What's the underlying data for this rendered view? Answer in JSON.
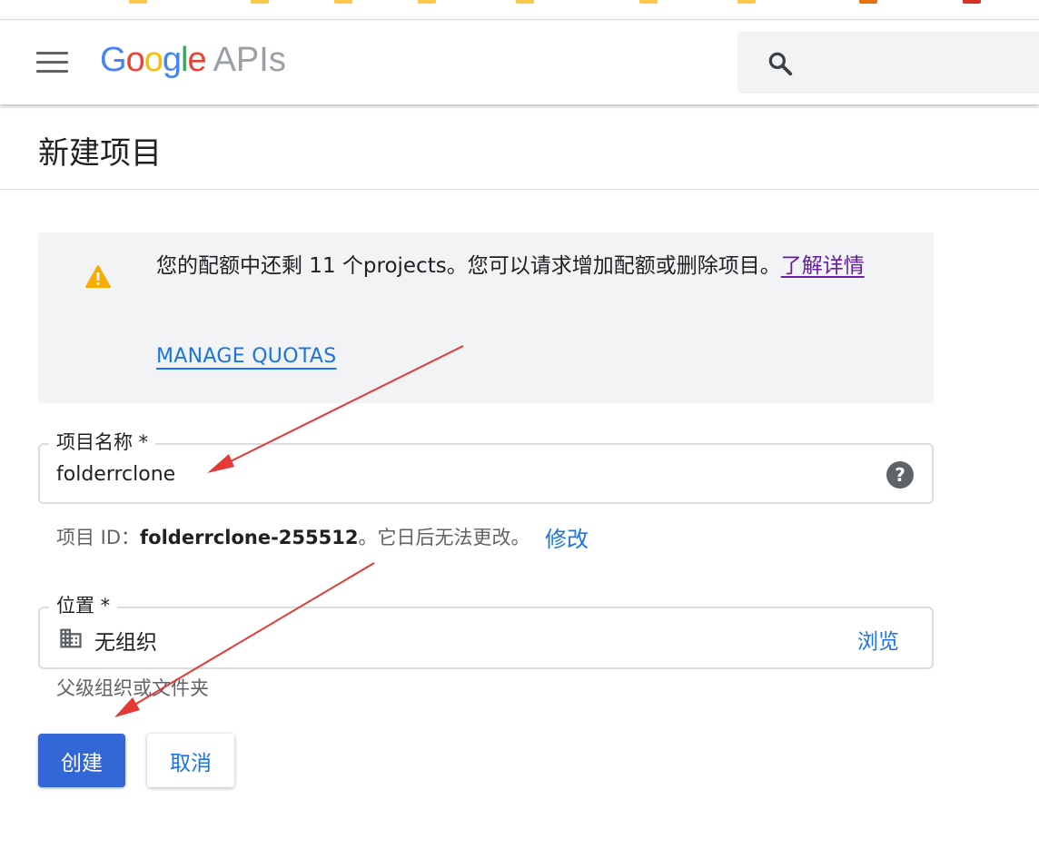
{
  "header": {
    "logo_google": "Google",
    "logo_apis": "APIs",
    "menu_icon": "hamburger-menu-icon",
    "search_icon": "search-icon"
  },
  "page": {
    "title": "新建项目"
  },
  "notice": {
    "icon": "warning-icon",
    "text": "您的配额中还剩 11 个projects。您可以请求增加配额或删除项目。",
    "learn_more": "了解详情",
    "manage_quotas": "MANAGE QUOTAS"
  },
  "project_name": {
    "label": "项目名称 *",
    "value": "folderrclone",
    "help_icon": "help-icon"
  },
  "project_id": {
    "prefix": "项目 ID：",
    "value": "folderrclone-255512",
    "suffix": "。它日后无法更改。",
    "edit": "修改"
  },
  "location": {
    "label": "位置 *",
    "icon": "building-icon",
    "value": "无组织",
    "browse": "浏览",
    "hint": "父级组织或文件夹"
  },
  "actions": {
    "create": "创建",
    "cancel": "取消"
  },
  "colors": {
    "primary": "#3367d6",
    "link": "#1a73e8",
    "visited_link": "#681da8",
    "warning": "#f9ab00",
    "notice_bg": "#f1f3f4",
    "arrow": "#e53935"
  }
}
